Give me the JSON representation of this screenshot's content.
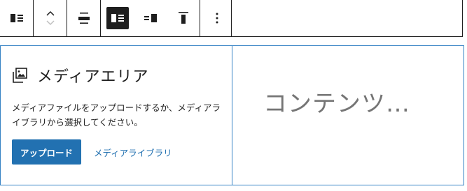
{
  "toolbar": {
    "groups": [
      {
        "buttons": [
          {
            "icon": "block-type-media-text-icon"
          }
        ]
      },
      {
        "buttons": [
          {
            "icon": "move-up-down-icon"
          }
        ]
      },
      {
        "buttons": [
          {
            "icon": "align-center-icon"
          }
        ]
      },
      {
        "buttons": [
          {
            "icon": "media-left-icon",
            "active": true
          },
          {
            "icon": "media-right-icon",
            "active": false
          },
          {
            "icon": "vertical-align-top-icon",
            "active": false
          }
        ]
      },
      {
        "buttons": [
          {
            "icon": "more-options-icon"
          }
        ]
      }
    ]
  },
  "media": {
    "title": "メディアエリア",
    "instructions": "メディアファイルをアップロードするか、メディアライブラリから選択してください。",
    "upload_label": "アップロード",
    "library_label": "メディアライブラリ"
  },
  "content": {
    "placeholder": "コンテンツ…"
  },
  "colors": {
    "accent": "#2271b1",
    "border": "#3582c4",
    "toolbar_border": "#1e1e1e",
    "placeholder_text": "#757575"
  }
}
